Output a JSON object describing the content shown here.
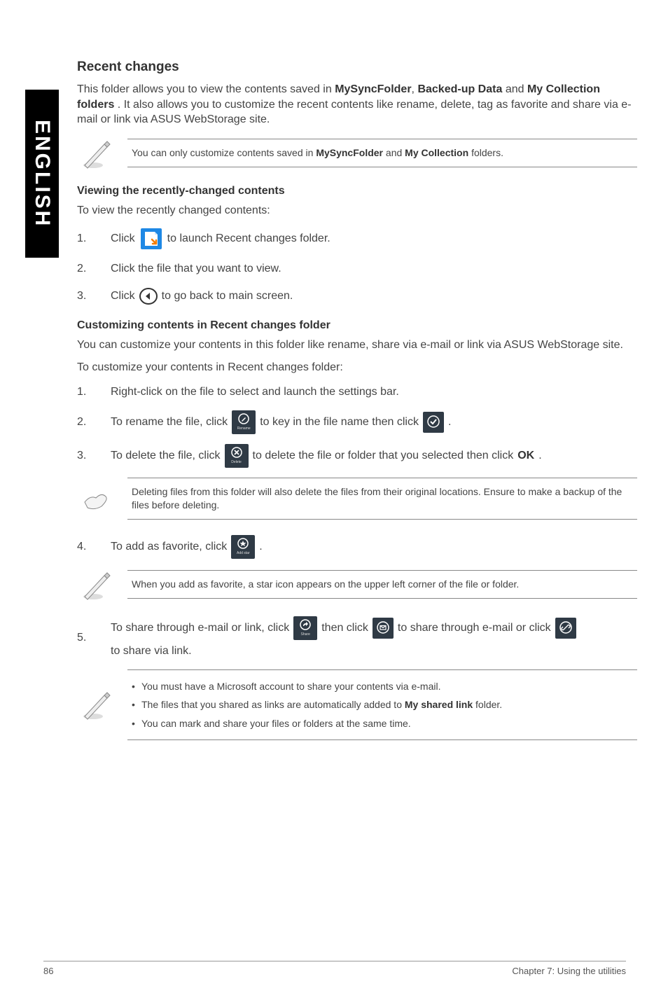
{
  "side_tab": "ENGLISH",
  "heading": "Recent changes",
  "intro": "This folder allows you to view the contents saved in {b1}, {b2} and {b3}. It also allows you to customize the recent contents like rename, delete, tag as favorite and share via e-mail or link via ASUS WebStorage site.",
  "intro_bold": {
    "b1": "MySyncFolder",
    "b2": "Backed-up Data",
    "b3": "My Collection folders"
  },
  "note1": {
    "pre": "You can only customize contents saved in ",
    "b1": "MySyncFolder",
    "mid": " and ",
    "b2": "My Collection",
    "post": " folders."
  },
  "viewing": {
    "title": "Viewing the recently-changed contents",
    "lead": "To view the recently changed contents:",
    "steps": {
      "s1": {
        "num": "1.",
        "pre": "Click ",
        "post": " to launch Recent changes folder."
      },
      "s2": {
        "num": "2.",
        "text": "Click the file that you want to view."
      },
      "s3": {
        "num": "3.",
        "pre": "Click ",
        "post": " to go back to main screen."
      }
    }
  },
  "customizing": {
    "title": "Customizing contents in Recent changes folder",
    "lead1": "You can customize your contents in this folder like rename, share via e-mail or link via ASUS WebStorage site.",
    "lead2": "To customize your contents in Recent changes folder:",
    "steps": {
      "s1": {
        "num": "1.",
        "text": "Right-click on the file to select and launch the settings bar."
      },
      "s2": {
        "num": "2.",
        "pre": "To rename the file, click ",
        "mid": " to key in the file name then click ",
        "post": "."
      },
      "s3": {
        "num": "3.",
        "pre": "To delete the file, click ",
        "mid": " to delete the file or folder that you selected then click ",
        "ok": "OK",
        "post": "."
      },
      "s4": {
        "num": "4.",
        "pre": "To add as favorite, click ",
        "post": "."
      },
      "s5": {
        "num": "5.",
        "pre": "To share through e-mail or link, click ",
        "mid1": " then click ",
        "mid2": " to share through e-mail or click ",
        "post": " to share via link."
      }
    }
  },
  "note_delete": "Deleting files from this folder will also delete the files from their original locations. Ensure to make a backup of the files before deleting.",
  "note_favorite": "When you add as favorite, a star icon appears on the upper left corner of the file or folder.",
  "note_share": {
    "li1": "You must have a Microsoft account to share your contents via e-mail.",
    "li2_pre": "The files that you shared as links are automatically added to ",
    "li2_b": "My shared link",
    "li2_post": " folder.",
    "li3": "You can mark and share your files or folders at the same time."
  },
  "icons": {
    "rename_label": "Rename",
    "delete_label": "Delete",
    "addstar_label": "Add star",
    "share_label": "Share"
  },
  "footer": {
    "page": "86",
    "chapter": "Chapter 7: Using the utilities"
  }
}
